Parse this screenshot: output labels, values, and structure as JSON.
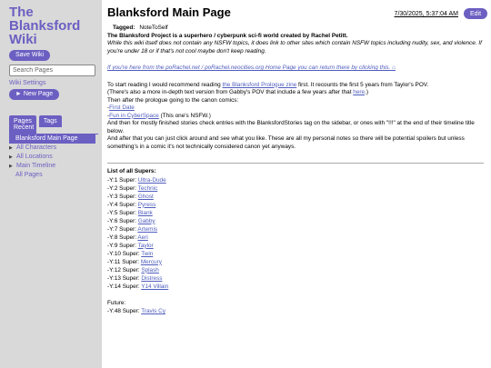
{
  "sidebar": {
    "title": "The Blanksford Wiki",
    "save_label": "Save Wiki",
    "search_placeholder": "Search Pages",
    "settings_label": "Wiki Settings",
    "new_page_label": "► New Page",
    "tabs": [
      "Pages",
      "Tags"
    ],
    "recent_label": "Recent",
    "tree": [
      {
        "label": "Blanksford Main Page",
        "caret": ""
      },
      {
        "label": "All Characters",
        "caret": "▶"
      },
      {
        "label": "All Locations",
        "caret": "▶"
      },
      {
        "label": "Main Timeline",
        "caret": "▶"
      },
      {
        "label": "All Pages",
        "caret": ""
      }
    ]
  },
  "header": {
    "title": "Blanksford Main Page",
    "timestamp": "7/30/2025, 5:37:04 AM",
    "edit_label": "Edit"
  },
  "content": {
    "tagged_label": "Tagged:",
    "tagged_value": "NoteToSelf",
    "intro": "The Blanksford Project is a superhero / cyberpunk sci-fi world created by Rachel Petitt.",
    "nsfw_note": "While this wiki itself does not contain any NSFW topics, it does link to other sites which contain NSFW topics including nudity, sex, and violence. If you're under 18 or if that's not cool maybe don't keep reading.",
    "return_link": "If you're here from the poRachel.net / poRachel.neocities.org Home Page you can return there by clicking this. ⌂",
    "p1_before": "To start reading I would recommend reading ",
    "p1_link": "the Blanksford Prologue zine",
    "p1_after": " first. It recounts the first 5 years from Taylor's POV.",
    "p2_before": "(There's also a more in-depth text version from Gabby's POV that include a few years after that ",
    "p2_link": "here",
    "p2_after": ".)",
    "p3": "Then after the prologue going to the canon comics:",
    "c1_prefix": "-",
    "c1_link": "First Date",
    "c2_prefix": "-",
    "c2_link": "Fun in CyberSpace",
    "c2_after": " (This one's NSFW.)",
    "p4": "And then for mostly finished stories check entries with the BlanksfordStories tag on the sidebar, or ones with \"!!!\" at the end of their timeline title below.",
    "p5": "And after that you can just click around and see what you like. These are all my personal notes so there will be potential spoilers but unless something's in a comic it's not technically considered canon yet anyways.",
    "supers_title": "List of all Supers:",
    "supers": [
      {
        "prefix": "-Y:1 Super: ",
        "name": "Ultra-Dude"
      },
      {
        "prefix": "-Y:2 Super: ",
        "name": "Technic"
      },
      {
        "prefix": "-Y:3 Super: ",
        "name": "Ghost"
      },
      {
        "prefix": "-Y:4 Super: ",
        "name": "Pyress"
      },
      {
        "prefix": "-Y:5 Super: ",
        "name": "Blank"
      },
      {
        "prefix": "-Y:6 Super: ",
        "name": "Gabby"
      },
      {
        "prefix": "-Y:7 Super: ",
        "name": "Artemis"
      },
      {
        "prefix": "-Y:8 Super: ",
        "name": "Aeri"
      },
      {
        "prefix": "-Y:9 Super: ",
        "name": "Taylor"
      },
      {
        "prefix": "-Y:10 Super: ",
        "name": "Twin"
      },
      {
        "prefix": "-Y:11 Super: ",
        "name": "Mercury"
      },
      {
        "prefix": "-Y:12 Super: ",
        "name": "Splash"
      },
      {
        "prefix": "-Y:13 Super: ",
        "name": "Distress"
      },
      {
        "prefix": "-Y:14 Super: ",
        "name": "Y14 Villain"
      }
    ],
    "future_label": "Future:",
    "future": [
      {
        "prefix": "-Y:48 Super: ",
        "name": "Travis Cy"
      }
    ]
  },
  "colors": {
    "accent": "#6b5fc2",
    "link": "#4e5cbd",
    "sidebar_bg": "#d9d9d9"
  }
}
